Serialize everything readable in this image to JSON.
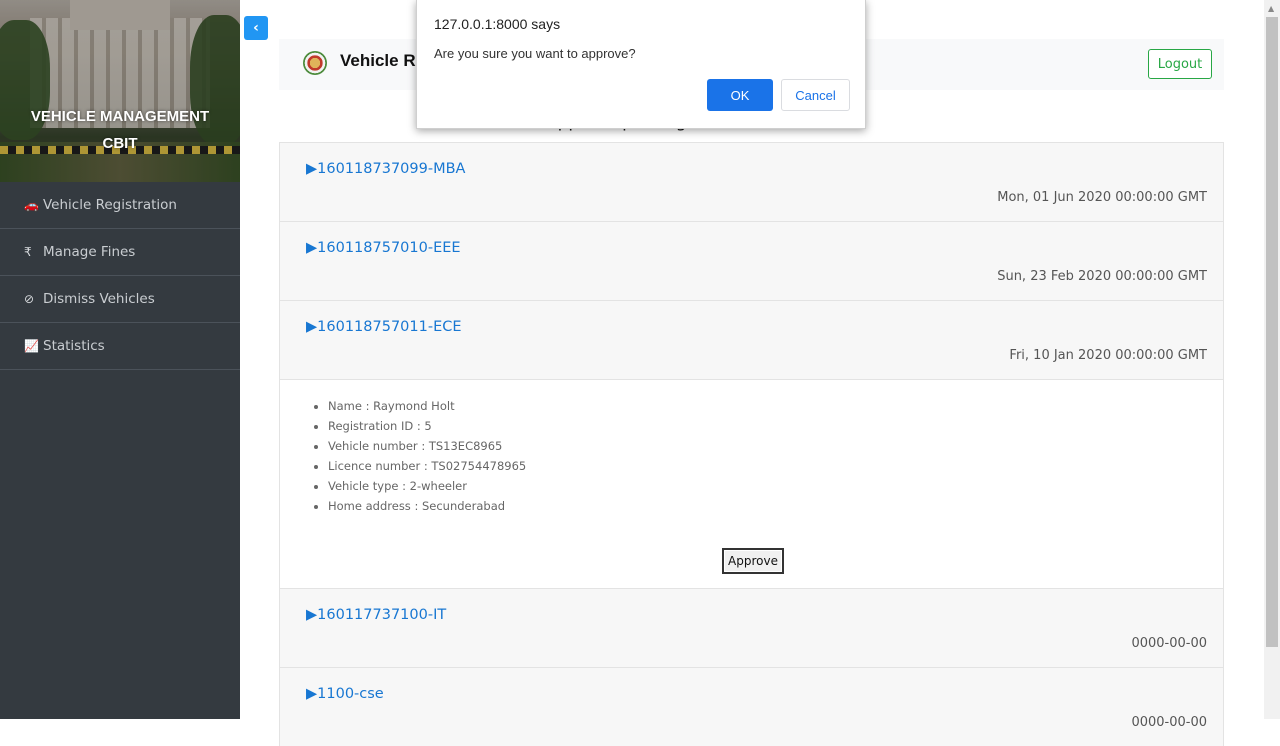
{
  "sidebar": {
    "title_line1": "VEHICLE MANAGEMENT",
    "title_line2": "CBIT",
    "items": [
      {
        "icon": "car-icon",
        "glyph": "🚗",
        "label": "Vehicle Registration"
      },
      {
        "icon": "rupee-icon",
        "glyph": "₹",
        "label": "Manage Fines"
      },
      {
        "icon": "ban-icon",
        "glyph": "⊘",
        "label": "Dismiss Vehicles"
      },
      {
        "icon": "line-chart-icon",
        "glyph": "📈",
        "label": "Statistics"
      }
    ]
  },
  "toggle": {
    "glyph": "‹"
  },
  "navbar": {
    "brand": "Vehicle Re",
    "logout_label": "Logout"
  },
  "page": {
    "heading": "Approve parking sticker"
  },
  "registrations": [
    {
      "id": "▶160118737099-MBA",
      "date": "Mon, 01 Jun 2020 00:00:00 GMT"
    },
    {
      "id": "▶160118757010-EEE",
      "date": "Sun, 23 Feb 2020 00:00:00 GMT"
    },
    {
      "id": "▶160118757011-ECE",
      "date": "Fri, 10 Jan 2020 00:00:00 GMT"
    },
    {
      "id": "▶160117737100-IT",
      "date": "0000-00-00"
    },
    {
      "id": "▶1100-cse",
      "date": "0000-00-00"
    }
  ],
  "details": {
    "name": "Name : Raymond Holt",
    "registration_id": "Registration ID : 5",
    "vehicle_number": "Vehicle number : TS13EC8965",
    "licence_number": "Licence number : TS02754478965",
    "vehicle_type": "Vehicle type : 2-wheeler",
    "home_address": "Home address : Secunderabad",
    "approve_label": "Approve"
  },
  "dialog": {
    "title": "127.0.0.1:8000 says",
    "message": "Are you sure you want to approve?",
    "ok_label": "OK",
    "cancel_label": "Cancel"
  },
  "colors": {
    "sidebar_bg": "#343a40",
    "link": "#1877d2",
    "logout": "#28a745",
    "dialog_ok": "#1a73e8"
  }
}
